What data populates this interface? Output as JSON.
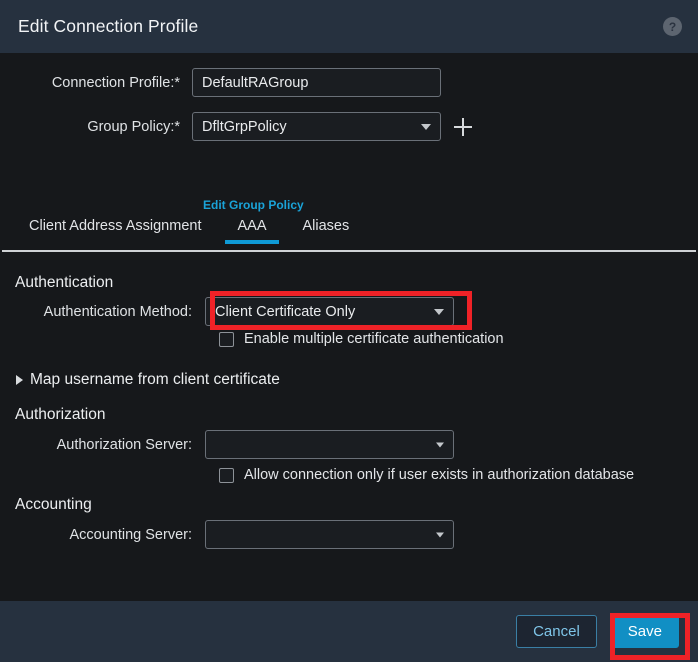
{
  "titlebar": {
    "title": "Edit Connection Profile",
    "help_icon": "help-question-icon",
    "help_glyph": "?"
  },
  "form": {
    "connection_profile": {
      "label": "Connection Profile:*",
      "value": "DefaultRAGroup",
      "placeholder": ""
    },
    "group_policy": {
      "label": "Group Policy:*",
      "value": "DfltGrpPolicy",
      "add_icon": "plus-icon"
    },
    "edit_group_policy_link": "Edit Group Policy"
  },
  "tabs": [
    {
      "label": "Client Address Assignment",
      "active": false
    },
    {
      "label": "AAA",
      "active": true
    },
    {
      "label": "Aliases",
      "active": false
    }
  ],
  "authentication": {
    "section_title": "Authentication",
    "method_label": "Authentication Method:",
    "method_value": "Client Certificate Only",
    "multi_cert_checkbox_label": "Enable multiple certificate authentication",
    "multi_cert_checked": false,
    "map_username_label": "Map username from client certificate",
    "map_username_expanded": false
  },
  "authorization": {
    "section_title": "Authorization",
    "server_label": "Authorization Server:",
    "server_value": "",
    "allow_connection_checkbox_label": "Allow connection only if user exists in authorization database",
    "allow_connection_checked": false
  },
  "accounting": {
    "section_title": "Accounting",
    "server_label": "Accounting Server:",
    "server_value": ""
  },
  "footer": {
    "cancel_label": "Cancel",
    "save_label": "Save"
  },
  "annotations": {
    "highlight_color": "#ef2227",
    "accent_color": "#0f9bd7",
    "link_color": "#1aa3d8",
    "titlebar_color": "#26313f",
    "body_color": "#16181b"
  }
}
